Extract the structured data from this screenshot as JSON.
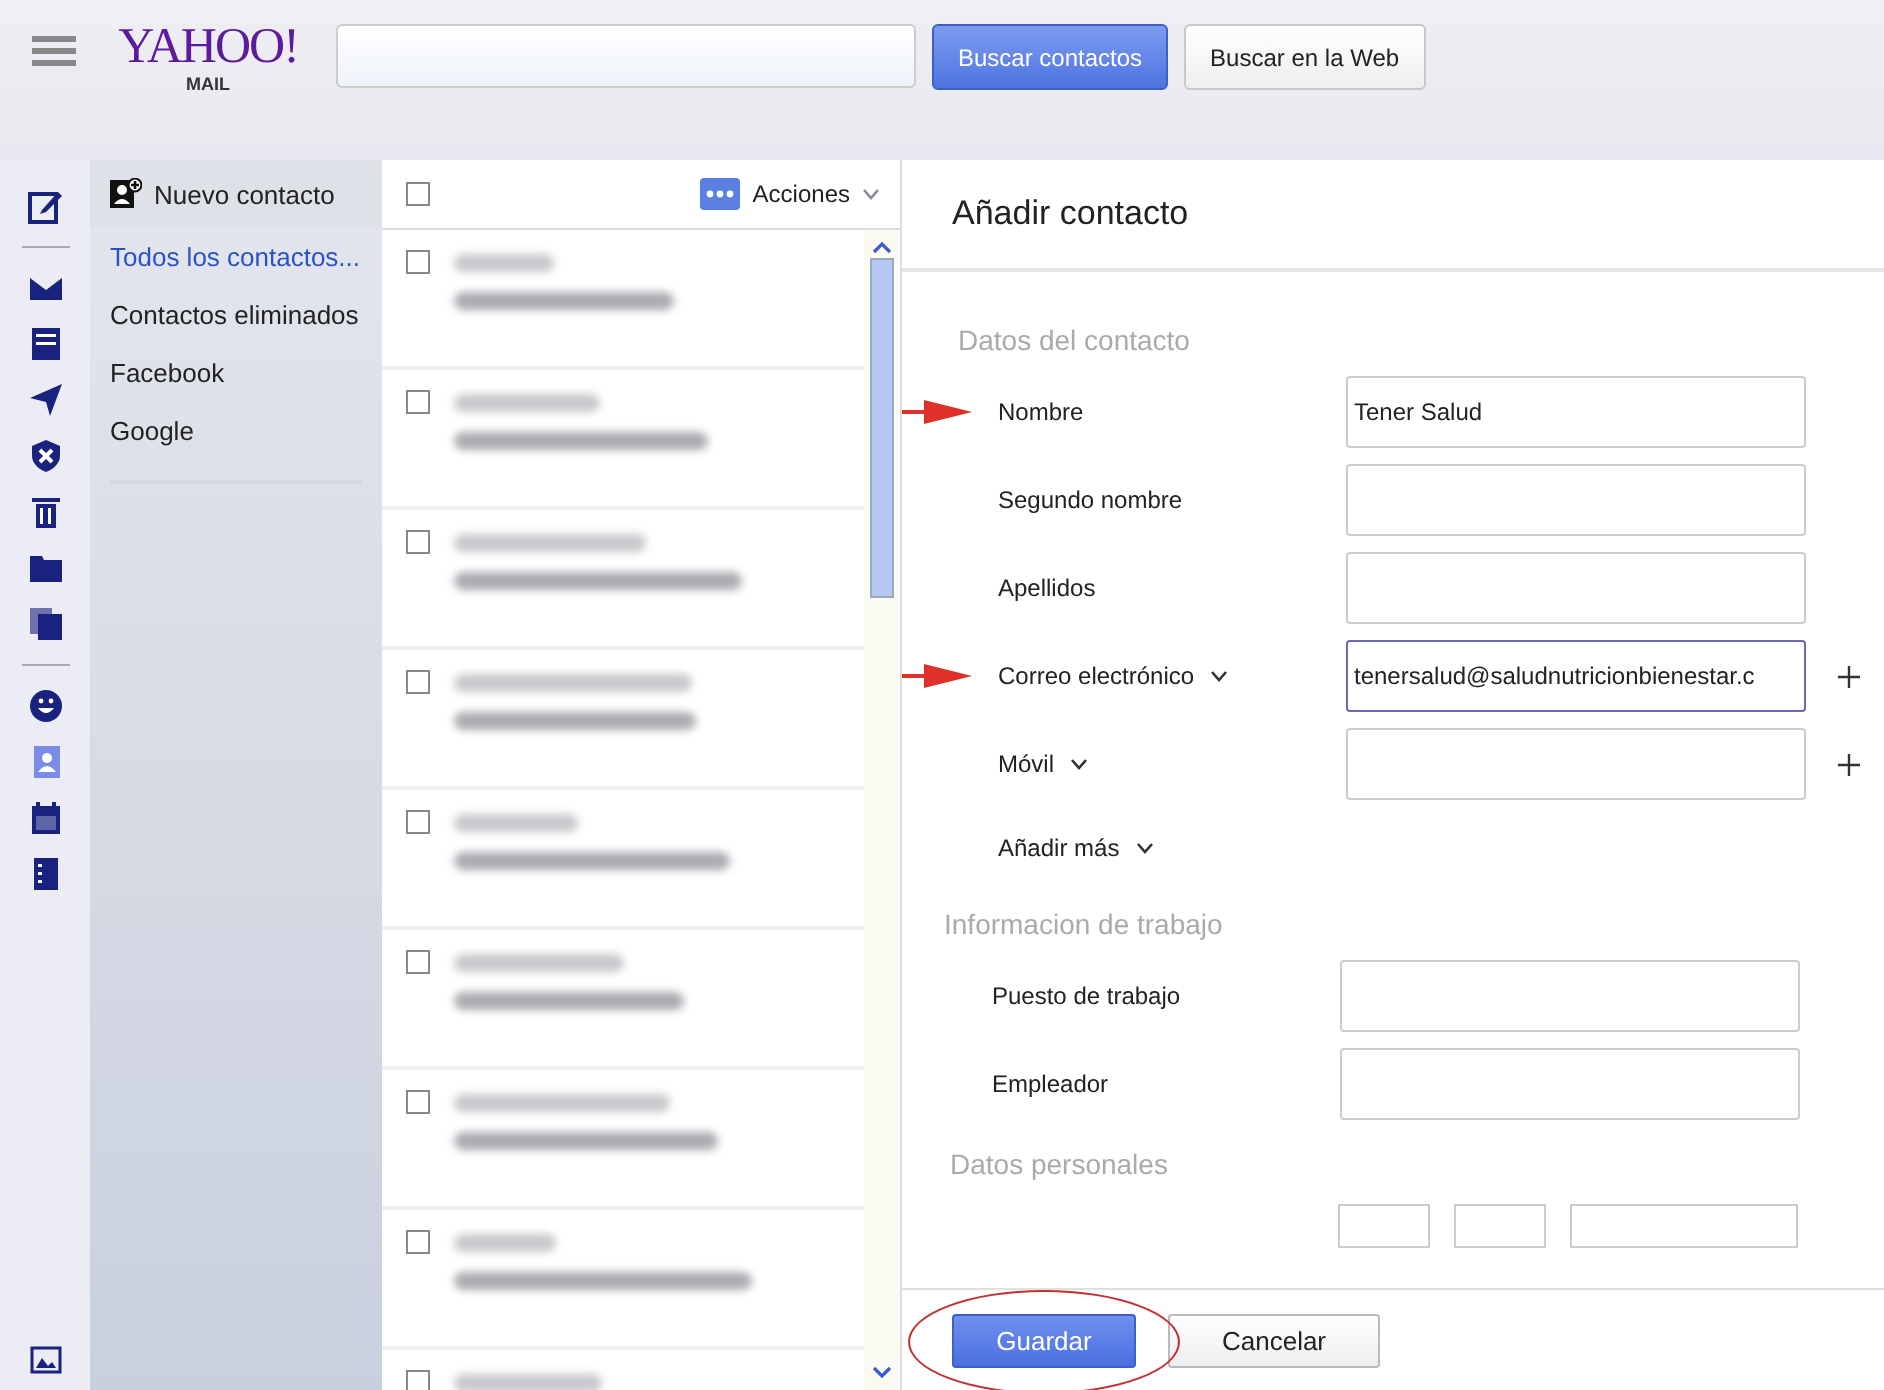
{
  "header": {
    "logo": "YAHOO!",
    "logo_sub": "MAIL",
    "buttons": [
      {
        "label": "Buscar contactos",
        "primary": true
      },
      {
        "label": "Buscar en la Web",
        "primary": false
      }
    ]
  },
  "rail": {
    "top": [
      {
        "kind": "compose",
        "selected": false
      }
    ],
    "middle": [
      {
        "kind": "mail",
        "selected": false
      },
      {
        "kind": "list",
        "selected": false
      },
      {
        "kind": "send",
        "selected": false
      },
      {
        "kind": "shield",
        "selected": false
      },
      {
        "kind": "trash",
        "selected": false
      },
      {
        "kind": "folder",
        "selected": false
      },
      {
        "kind": "copies",
        "selected": false
      }
    ],
    "bottom": [
      {
        "kind": "smiley",
        "selected": false
      },
      {
        "kind": "contacts",
        "selected": true
      },
      {
        "kind": "calendar",
        "selected": false
      },
      {
        "kind": "notepad",
        "selected": false
      }
    ]
  },
  "sidebar": {
    "new_contact": "Nuevo contacto",
    "items": [
      {
        "label": "Todos los contactos...",
        "selected": true
      },
      {
        "label": "Contactos eliminados",
        "selected": false
      },
      {
        "label": "Facebook",
        "selected": false
      },
      {
        "label": "Google",
        "selected": false
      }
    ]
  },
  "contact_list": {
    "select_all": false,
    "actions": "Acciones",
    "rows": [
      {
        "checked": false
      },
      {
        "checked": false
      },
      {
        "checked": false
      },
      {
        "checked": false
      },
      {
        "checked": false
      },
      {
        "checked": false
      },
      {
        "checked": false
      },
      {
        "checked": false
      },
      {
        "checked": false
      }
    ]
  },
  "form": {
    "title": "Añadir contacto",
    "sections": [
      {
        "title": "Datos del contacto",
        "fields": [
          {
            "label": "Nombre",
            "value": "Tener Salud",
            "dropdown": false,
            "add": false,
            "focused": false,
            "arrow": true
          },
          {
            "label": "Segundo nombre",
            "dropdown": false,
            "add": false,
            "focused": false,
            "arrow": false
          },
          {
            "label": "Apellidos",
            "dropdown": false,
            "add": false,
            "focused": false,
            "arrow": false
          },
          {
            "label": "Correo electrónico",
            "value": "tenersalud@saludnutricionbienestar.c",
            "dropdown": true,
            "add": true,
            "focused": true,
            "arrow": true
          },
          {
            "label": "Móvil",
            "dropdown": true,
            "add": true,
            "focused": false,
            "arrow": false
          }
        ],
        "more": "Añadir más"
      },
      {
        "title": "Informacion de trabajo",
        "fields": [
          {
            "label": "Puesto de trabajo",
            "dropdown": false,
            "add": false,
            "focused": false,
            "arrow": false
          },
          {
            "label": "Empleador",
            "dropdown": false,
            "add": false,
            "focused": false,
            "arrow": false
          }
        ]
      },
      {
        "title": "Datos personales"
      }
    ],
    "save": "Guardar",
    "cancel": "Cancelar",
    "save_circled": true
  }
}
